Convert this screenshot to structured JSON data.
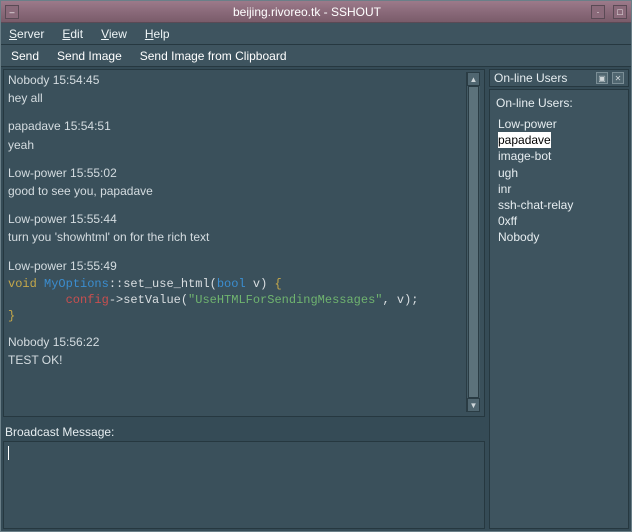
{
  "title": "beijing.rivoreo.tk - SSHOUT",
  "menubar": {
    "server": "Server",
    "edit": "Edit",
    "view": "View",
    "help": "Help"
  },
  "toolbar": {
    "send": "Send",
    "send_image": "Send Image",
    "send_image_clip": "Send Image from Clipboard"
  },
  "chat": {
    "m1_meta": "Nobody 15:54:45",
    "m1_text": "hey all",
    "m2_meta": "papadave 15:54:51",
    "m2_text": "yeah",
    "m3_meta": "Low-power 15:55:02",
    "m3_text": "good to see you, papadave",
    "m4_meta": "Low-power 15:55:44",
    "m4_text": "turn you 'showhtml' on for the rich text",
    "m5_meta": "Low-power 15:55:49",
    "code": {
      "void": "void ",
      "cls": "MyOptions",
      "fn1": "::set_use_html(",
      "bool": "bool",
      "fn2": " v) ",
      "br_open": "{",
      "indent": "        ",
      "cfg": "config",
      "set": "->setValue(",
      "str": "\"UseHTMLForSendingMessages\"",
      "tail": ", v);",
      "br_close": "}"
    },
    "m6_meta": "Nobody 15:56:22",
    "m6_text": "TEST OK!"
  },
  "broadcast": {
    "label": "Broadcast Message:"
  },
  "users": {
    "panel_title": "On-line Users",
    "panel_title2": "On-line Users:",
    "list": {
      "u0": "Low-power",
      "u1": "papadave",
      "u2": "image-bot",
      "u3": "ugh",
      "u4": "inr",
      "u5": "ssh-chat-relay",
      "u6": "0xff",
      "u7": "Nobody"
    }
  }
}
